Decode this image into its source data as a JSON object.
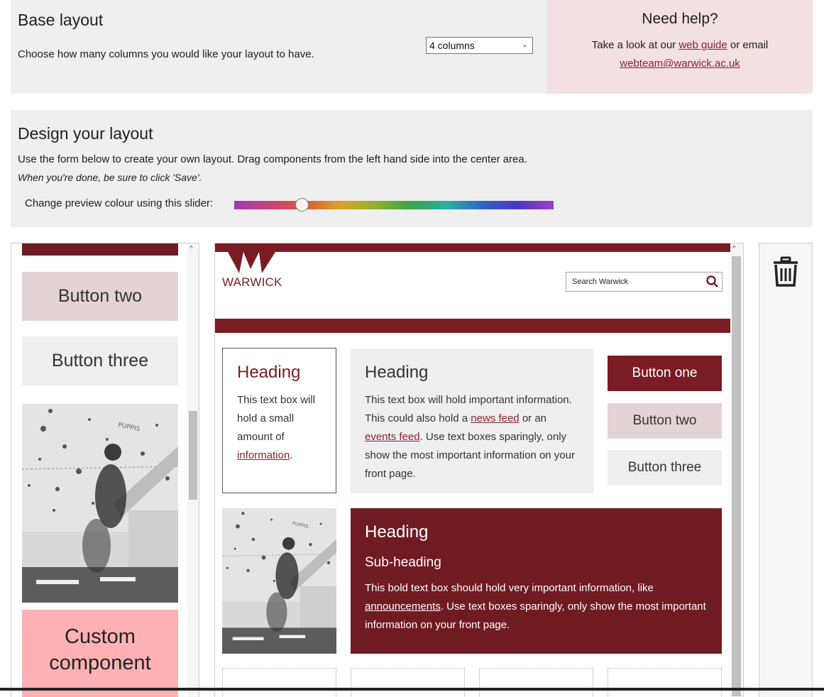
{
  "base": {
    "title": "Base layout",
    "description": "Choose how many columns you would like your layout to have.",
    "columns_selected": "4 columns"
  },
  "help": {
    "title": "Need help?",
    "line1_pre": "Take a look at our",
    "web_guide_link": "web guide",
    "line1_post": "or email",
    "email_link": "webteam@warwick.ac.uk"
  },
  "design": {
    "title": "Design your layout",
    "instructions": "Use the form below to create your own layout. Drag components from the left hand side into the center area.",
    "save_note": "When you're done, be sure to click 'Save'.",
    "slider_label": "Change preview colour using this slider:",
    "slider_value_fraction": 0.2
  },
  "palette": {
    "button_two": "Button two",
    "button_three": "Button three",
    "custom_component": "Custom component",
    "scrollbar_position_fraction": 0.62
  },
  "preview": {
    "logo_text": "WARWICK",
    "search_placeholder": "Search Warwick",
    "small_box": {
      "heading": "Heading",
      "text_pre": "This text box will hold a small amount of",
      "link": "information",
      "text_post": "."
    },
    "grey_box": {
      "heading": "Heading",
      "text1": "This text box will hold important information. This could also hold a",
      "link1": "news feed",
      "text2": "or an",
      "link2": "events feed",
      "text3": ". Use text boxes sparingly, only show the most important information on your front page."
    },
    "buttons": [
      "Button one",
      "Button two",
      "Button three"
    ],
    "bold_box": {
      "heading": "Heading",
      "subheading": "Sub-heading",
      "text1": "This bold text box should hold very important information, like",
      "link": "announcements",
      "text2": ". Use text boxes sparingly, only show the most important information on your front page."
    }
  },
  "icons": {
    "trash": "trash-icon",
    "search": "search-icon",
    "select": "chevron-down-icon",
    "scroll_up": "chevron-up-icon"
  },
  "colors": {
    "brand": "#7a1c24",
    "bold_box": "#701b22",
    "button_two": "#e3d3d4",
    "custom_component": "#ffb1b3",
    "help_panel": "#f2e0e2",
    "link": "#8b2331"
  }
}
